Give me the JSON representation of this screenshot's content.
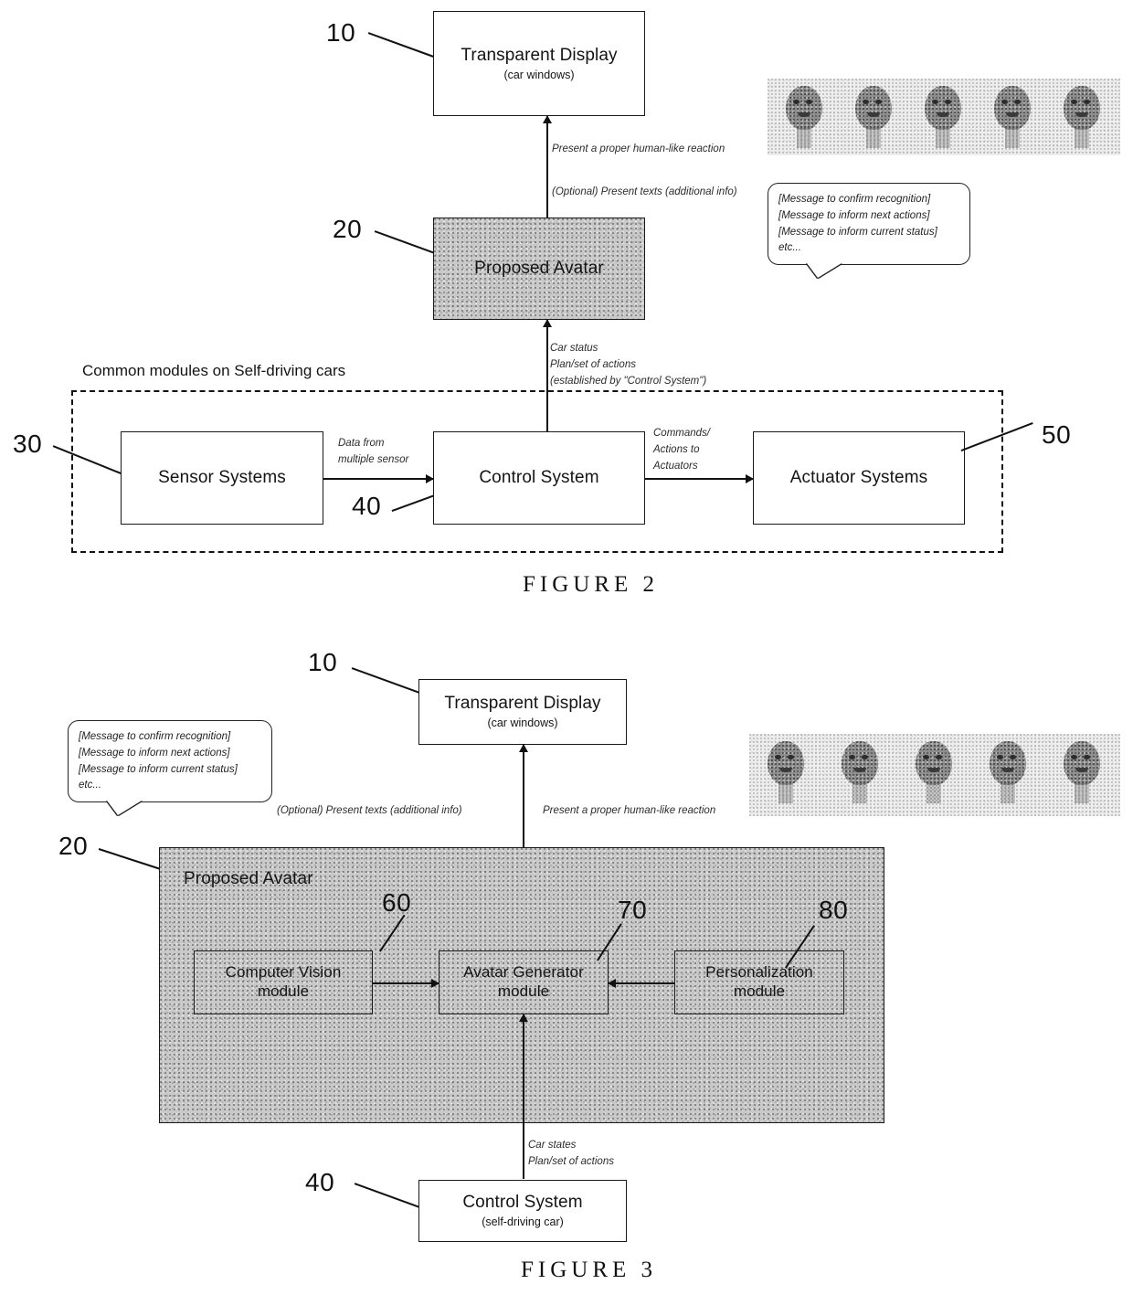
{
  "document": {
    "type": "patent-figure-sheet",
    "figures": [
      "FIGURE 2",
      "FIGURE 3"
    ]
  },
  "figure2": {
    "caption": "FIGURE 2",
    "numerals": {
      "display": "10",
      "avatar": "20",
      "sensor": "30",
      "control": "40",
      "actuator": "50"
    },
    "boxes": {
      "transparent_display": {
        "title": "Transparent Display",
        "subtitle": "(car windows)"
      },
      "proposed_avatar": {
        "title": "Proposed Avatar"
      },
      "sensor_systems": {
        "title": "Sensor Systems"
      },
      "control_system": {
        "title": "Control System"
      },
      "actuator_systems": {
        "title": "Actuator Systems"
      }
    },
    "annotations": {
      "reaction": "Present a proper human-like reaction",
      "texts": "(Optional) Present texts (additional info)",
      "car_status_line1": "Car status",
      "car_status_line2": "Plan/set of actions",
      "car_status_line3": "(established by \"Control System\")",
      "sensor_data_line1": "Data from",
      "sensor_data_line2": "multiple sensor",
      "actuator_cmd_line1": "Commands/",
      "actuator_cmd_line2": "Actions to",
      "actuator_cmd_line3": "Actuators"
    },
    "region_label": "Common modules on Self-driving cars",
    "speech_bubble": [
      "[Message to confirm recognition]",
      "[Message to inform next actions]",
      "[Message to inform current status]",
      "etc..."
    ],
    "avatar_strip": {
      "count": 5,
      "description": "avatar face expression samples"
    }
  },
  "figure3": {
    "caption": "FIGURE 3",
    "numerals": {
      "display": "10",
      "avatar": "20",
      "control": "40",
      "computer_vision": "60",
      "avatar_generator": "70",
      "personalization": "80"
    },
    "boxes": {
      "transparent_display": {
        "title": "Transparent Display",
        "subtitle": "(car windows)"
      },
      "proposed_avatar": {
        "title": "Proposed Avatar"
      },
      "computer_vision": {
        "line1": "Computer Vision",
        "line2": "module"
      },
      "avatar_generator": {
        "line1": "Avatar Generator",
        "line2": "module"
      },
      "personalization": {
        "line1": "Personalization",
        "line2": "module"
      },
      "control_system": {
        "title": "Control System",
        "subtitle": "(self-driving car)"
      }
    },
    "annotations": {
      "texts": "(Optional) Present texts (additional info)",
      "reaction": "Present a proper human-like reaction",
      "car_states_line1": "Car states",
      "car_states_line2": "Plan/set of actions"
    },
    "speech_bubble": [
      "[Message to confirm recognition]",
      "[Message to inform next actions]",
      "[Message to inform current status]",
      "etc..."
    ],
    "avatar_strip": {
      "count": 5,
      "description": "avatar face expression samples"
    }
  },
  "colors": {
    "ink": "#111111",
    "shaded_fill": "#c9c9c9",
    "page": "#ffffff"
  }
}
